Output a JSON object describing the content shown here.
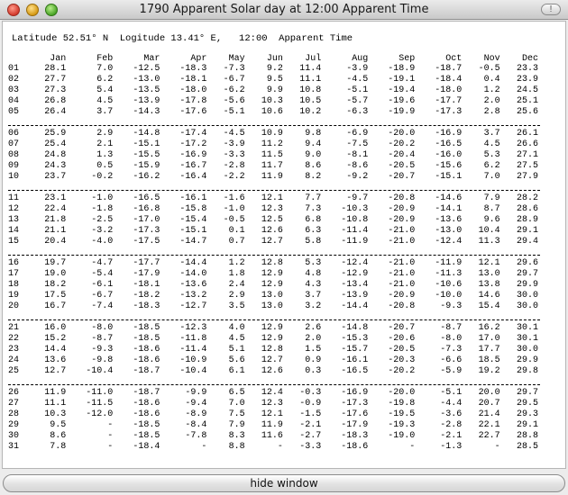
{
  "window": {
    "title": "1790 Apparent Solar day at 12:00  Apparent Time",
    "toolbar_icon": "exclamation-icon"
  },
  "header": {
    "text": "Latitude 52.51° N  Logitude 13.41° E,   12:00  Apparent Time"
  },
  "columns": [
    "",
    "Jan",
    "Feb",
    "Mar",
    "Apr",
    "May",
    "Jun",
    "Jul",
    "Aug",
    "Sep",
    "Oct",
    "Nov",
    "Dec"
  ],
  "groups": [
    [
      [
        "01",
        "28.1",
        "7.0",
        "-12.5",
        "-18.3",
        "-7.3",
        "9.2",
        "11.4",
        "-3.9",
        "-18.9",
        "-18.7",
        "-0.5",
        "23.3"
      ],
      [
        "02",
        "27.7",
        "6.2",
        "-13.0",
        "-18.1",
        "-6.7",
        "9.5",
        "11.1",
        "-4.5",
        "-19.1",
        "-18.4",
        "0.4",
        "23.9"
      ],
      [
        "03",
        "27.3",
        "5.4",
        "-13.5",
        "-18.0",
        "-6.2",
        "9.9",
        "10.8",
        "-5.1",
        "-19.4",
        "-18.0",
        "1.2",
        "24.5"
      ],
      [
        "04",
        "26.8",
        "4.5",
        "-13.9",
        "-17.8",
        "-5.6",
        "10.3",
        "10.5",
        "-5.7",
        "-19.6",
        "-17.7",
        "2.0",
        "25.1"
      ],
      [
        "05",
        "26.4",
        "3.7",
        "-14.3",
        "-17.6",
        "-5.1",
        "10.6",
        "10.2",
        "-6.3",
        "-19.9",
        "-17.3",
        "2.8",
        "25.6"
      ]
    ],
    [
      [
        "06",
        "25.9",
        "2.9",
        "-14.8",
        "-17.4",
        "-4.5",
        "10.9",
        "9.8",
        "-6.9",
        "-20.0",
        "-16.9",
        "3.7",
        "26.1"
      ],
      [
        "07",
        "25.4",
        "2.1",
        "-15.1",
        "-17.2",
        "-3.9",
        "11.2",
        "9.4",
        "-7.5",
        "-20.2",
        "-16.5",
        "4.5",
        "26.6"
      ],
      [
        "08",
        "24.8",
        "1.3",
        "-15.5",
        "-16.9",
        "-3.3",
        "11.5",
        "9.0",
        "-8.1",
        "-20.4",
        "-16.0",
        "5.3",
        "27.1"
      ],
      [
        "09",
        "24.3",
        "0.5",
        "-15.9",
        "-16.7",
        "-2.8",
        "11.7",
        "8.6",
        "-8.6",
        "-20.5",
        "-15.6",
        "6.2",
        "27.5"
      ],
      [
        "10",
        "23.7",
        "-0.2",
        "-16.2",
        "-16.4",
        "-2.2",
        "11.9",
        "8.2",
        "-9.2",
        "-20.7",
        "-15.1",
        "7.0",
        "27.9"
      ]
    ],
    [
      [
        "11",
        "23.1",
        "-1.0",
        "-16.5",
        "-16.1",
        "-1.6",
        "12.1",
        "7.7",
        "-9.7",
        "-20.8",
        "-14.6",
        "7.9",
        "28.2"
      ],
      [
        "12",
        "22.4",
        "-1.8",
        "-16.8",
        "-15.8",
        "-1.0",
        "12.3",
        "7.3",
        "-10.3",
        "-20.9",
        "-14.1",
        "8.7",
        "28.6"
      ],
      [
        "13",
        "21.8",
        "-2.5",
        "-17.0",
        "-15.4",
        "-0.5",
        "12.5",
        "6.8",
        "-10.8",
        "-20.9",
        "-13.6",
        "9.6",
        "28.9"
      ],
      [
        "14",
        "21.1",
        "-3.2",
        "-17.3",
        "-15.1",
        "0.1",
        "12.6",
        "6.3",
        "-11.4",
        "-21.0",
        "-13.0",
        "10.4",
        "29.1"
      ],
      [
        "15",
        "20.4",
        "-4.0",
        "-17.5",
        "-14.7",
        "0.7",
        "12.7",
        "5.8",
        "-11.9",
        "-21.0",
        "-12.4",
        "11.3",
        "29.4"
      ]
    ],
    [
      [
        "16",
        "19.7",
        "-4.7",
        "-17.7",
        "-14.4",
        "1.2",
        "12.8",
        "5.3",
        "-12.4",
        "-21.0",
        "-11.9",
        "12.1",
        "29.6"
      ],
      [
        "17",
        "19.0",
        "-5.4",
        "-17.9",
        "-14.0",
        "1.8",
        "12.9",
        "4.8",
        "-12.9",
        "-21.0",
        "-11.3",
        "13.0",
        "29.7"
      ],
      [
        "18",
        "18.2",
        "-6.1",
        "-18.1",
        "-13.6",
        "2.4",
        "12.9",
        "4.3",
        "-13.4",
        "-21.0",
        "-10.6",
        "13.8",
        "29.9"
      ],
      [
        "19",
        "17.5",
        "-6.7",
        "-18.2",
        "-13.2",
        "2.9",
        "13.0",
        "3.7",
        "-13.9",
        "-20.9",
        "-10.0",
        "14.6",
        "30.0"
      ],
      [
        "20",
        "16.7",
        "-7.4",
        "-18.3",
        "-12.7",
        "3.5",
        "13.0",
        "3.2",
        "-14.4",
        "-20.8",
        "-9.3",
        "15.4",
        "30.0"
      ]
    ],
    [
      [
        "21",
        "16.0",
        "-8.0",
        "-18.5",
        "-12.3",
        "4.0",
        "12.9",
        "2.6",
        "-14.8",
        "-20.7",
        "-8.7",
        "16.2",
        "30.1"
      ],
      [
        "22",
        "15.2",
        "-8.7",
        "-18.5",
        "-11.8",
        "4.5",
        "12.9",
        "2.0",
        "-15.3",
        "-20.6",
        "-8.0",
        "17.0",
        "30.1"
      ],
      [
        "23",
        "14.4",
        "-9.3",
        "-18.6",
        "-11.4",
        "5.1",
        "12.8",
        "1.5",
        "-15.7",
        "-20.5",
        "-7.3",
        "17.7",
        "30.0"
      ],
      [
        "24",
        "13.6",
        "-9.8",
        "-18.6",
        "-10.9",
        "5.6",
        "12.7",
        "0.9",
        "-16.1",
        "-20.3",
        "-6.6",
        "18.5",
        "29.9"
      ],
      [
        "25",
        "12.7",
        "-10.4",
        "-18.7",
        "-10.4",
        "6.1",
        "12.6",
        "0.3",
        "-16.5",
        "-20.2",
        "-5.9",
        "19.2",
        "29.8"
      ]
    ],
    [
      [
        "26",
        "11.9",
        "-11.0",
        "-18.7",
        "-9.9",
        "6.5",
        "12.4",
        "-0.3",
        "-16.9",
        "-20.0",
        "-5.1",
        "20.0",
        "29.7"
      ],
      [
        "27",
        "11.1",
        "-11.5",
        "-18.6",
        "-9.4",
        "7.0",
        "12.3",
        "-0.9",
        "-17.3",
        "-19.8",
        "-4.4",
        "20.7",
        "29.5"
      ],
      [
        "28",
        "10.3",
        "-12.0",
        "-18.6",
        "-8.9",
        "7.5",
        "12.1",
        "-1.5",
        "-17.6",
        "-19.5",
        "-3.6",
        "21.4",
        "29.3"
      ],
      [
        "29",
        "9.5",
        "-",
        "-18.5",
        "-8.4",
        "7.9",
        "11.9",
        "-2.1",
        "-17.9",
        "-19.3",
        "-2.8",
        "22.1",
        "29.1"
      ],
      [
        "30",
        "8.6",
        "-",
        "-18.5",
        "-7.8",
        "8.3",
        "11.6",
        "-2.7",
        "-18.3",
        "-19.0",
        "-2.1",
        "22.7",
        "28.8"
      ],
      [
        "31",
        "7.8",
        "-",
        "-18.4",
        "-",
        "8.8",
        "-",
        "-3.3",
        "-18.6",
        "-",
        "-1.3",
        "-",
        "28.5"
      ]
    ]
  ],
  "separator": "-----------------------------------------------------------------------------------------------",
  "footer": {
    "hide_button": "hide window"
  }
}
